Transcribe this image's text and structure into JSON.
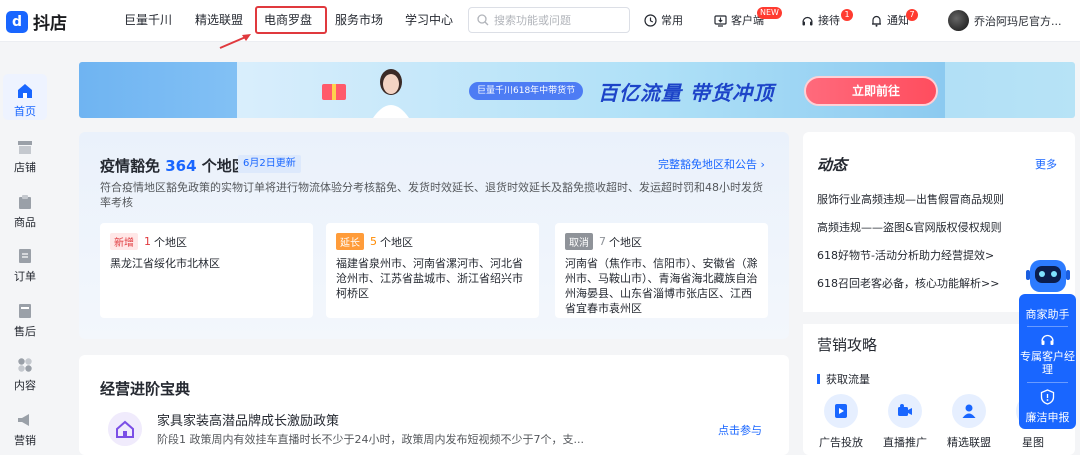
{
  "app": {
    "logo_mark": "d",
    "logo_text": "抖店"
  },
  "nav": {
    "items": [
      "巨量千川",
      "精选联盟",
      "电商罗盘",
      "服务市场",
      "学习中心"
    ],
    "highlighted": "电商罗盘"
  },
  "search": {
    "placeholder": "搜索功能或问题"
  },
  "toolbar": {
    "common": "常用",
    "client": "客户端",
    "client_badge": "NEW",
    "reception": "接待",
    "reception_badge": "1",
    "notice": "通知",
    "notice_badge": "7",
    "user_name": "乔治阿玛尼官方..."
  },
  "sidebar": {
    "items": [
      {
        "label": "首页",
        "icon": "home-icon",
        "active": true
      },
      {
        "label": "店铺",
        "icon": "shop-icon"
      },
      {
        "label": "商品",
        "icon": "goods-icon"
      },
      {
        "label": "订单",
        "icon": "order-icon"
      },
      {
        "label": "售后",
        "icon": "aftersale-icon"
      },
      {
        "label": "内容",
        "icon": "content-icon"
      },
      {
        "label": "营销",
        "icon": "marketing-icon"
      }
    ]
  },
  "banner": {
    "tag": "巨量千川618年中带货节",
    "title": "百亿流量 带货冲顶",
    "cta": "立即前往"
  },
  "exemption": {
    "title_prefix": "疫情豁免",
    "count": "364",
    "title_suffix": "个地区",
    "date_tag": "6月2日更新",
    "link": "完整豁免地区和公告 ›",
    "desc": "符合疫情地区豁免政策的实物订单将进行物流体验分考核豁免、发货时效延长、退货时效延长及豁免揽收超时、发运超时罚和48小时发货率考核",
    "boxes": [
      {
        "tag": "新增",
        "count": "1",
        "unit": "个地区",
        "body": "黑龙江省绥化市北林区"
      },
      {
        "tag": "延长",
        "count": "5",
        "unit": "个地区",
        "body": "福建省泉州市、河南省漯河市、河北省沧州市、江苏省盐城市、浙江省绍兴市柯桥区"
      },
      {
        "tag": "取消",
        "count": "7",
        "unit": "个地区",
        "body": "河南省（焦作市、信阳市）、安徽省（滁州市、马鞍山市）、青海省海北藏族自治州海晏县、山东省淄博市张店区、江西省宜春市袁州区"
      }
    ]
  },
  "guide": {
    "title": "经营进阶宝典",
    "item_title": "家具家装高潜品牌成长激励政策",
    "item_desc": "阶段1 政策周内有效挂车直播时长不少于24小时，政策周内发布短视频不少于7个，支...",
    "action": "点击参与"
  },
  "news": {
    "title": "动态",
    "more": "更多",
    "items": [
      "服饰行业高频违规—出售假冒商品规则",
      "高频违规——盗图&官网版权侵权规则",
      "618好物节-活动分析助力经营提效>",
      "618召回老客必备，核心功能解析>>"
    ]
  },
  "marketing": {
    "title": "营销攻略",
    "subtitle": "获取流量",
    "items": [
      "广告投放",
      "直播推广",
      "精选联盟",
      "星图"
    ]
  },
  "assistant": {
    "merchant": "商家助手",
    "manager": "专属客户经理",
    "integrity": "廉洁申报"
  },
  "colors": {
    "brand": "#1966ff",
    "highlight_border": "#e0393e",
    "new": "#e0393e",
    "extend": "#ff9c3a",
    "cancel": "#8f9399"
  }
}
